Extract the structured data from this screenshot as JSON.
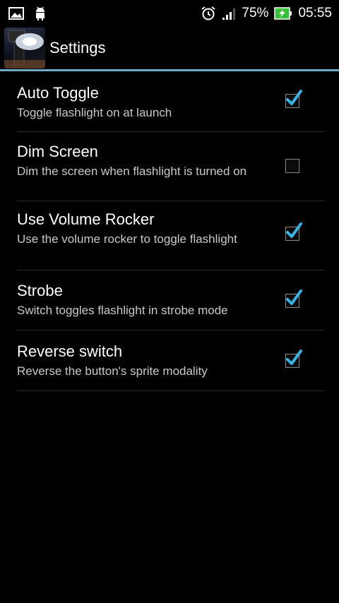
{
  "status_bar": {
    "battery_percent": "75%",
    "time": "05:55",
    "icons": [
      "gallery-icon",
      "android-icon",
      "alarm-icon",
      "signal-icon",
      "battery-charging-icon"
    ]
  },
  "action_bar": {
    "title": "Settings",
    "app_icon": "flashlight-app-icon"
  },
  "accent_color": "#33b5e5",
  "preferences": [
    {
      "title": "Auto Toggle",
      "summary": "Toggle flashlight on at launch",
      "checked": true
    },
    {
      "title": "Dim Screen",
      "summary": "Dim the screen when flashlight is turned on",
      "checked": false
    },
    {
      "title": "Use Volume Rocker",
      "summary": "Use the volume rocker to toggle flashlight",
      "checked": true
    },
    {
      "title": "Strobe",
      "summary": "Switch toggles flashlight in strobe mode",
      "checked": true
    },
    {
      "title": "Reverse switch",
      "summary": "Reverse the button's sprite modality",
      "checked": true
    }
  ]
}
